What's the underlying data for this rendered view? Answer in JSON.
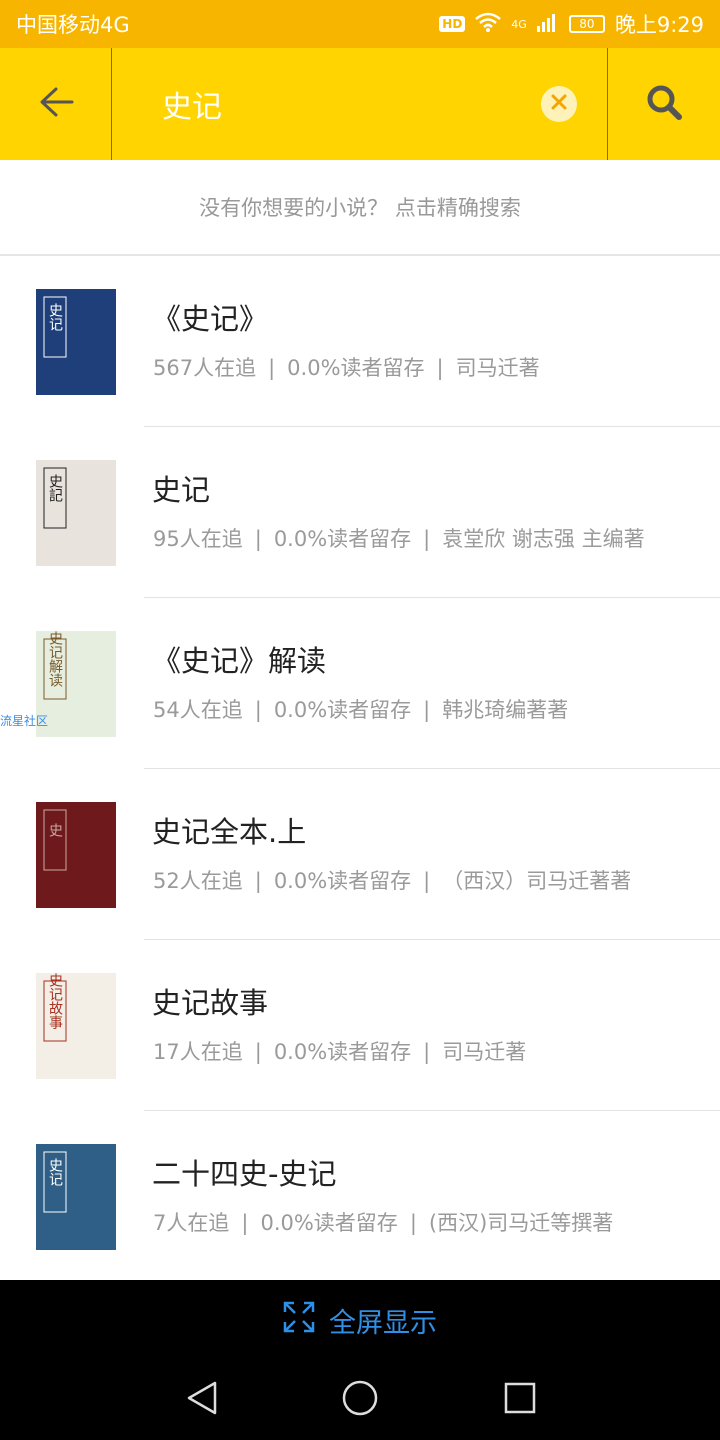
{
  "status_bar": {
    "carrier": "中国移动4G",
    "hd_badge": "HD",
    "network": "4G",
    "battery": "80",
    "time": "晚上9:29"
  },
  "search": {
    "query": "史记",
    "icons": [
      "arrow-left-icon",
      "clear-icon",
      "search-icon"
    ]
  },
  "hint": "没有你想要的小说？ 点击精确搜索",
  "results": [
    {
      "title": "《史记》",
      "followers": "567人在追",
      "retention": "0.0%读者留存",
      "author": "司马迁著",
      "cover": {
        "bg": "#1f3f7a",
        "text": "史记",
        "fg": "#ffffff"
      }
    },
    {
      "title": "史记",
      "followers": "95人在追",
      "retention": "0.0%读者留存",
      "author": "袁堂欣 谢志强 主编著",
      "cover": {
        "bg": "#e8e3dc",
        "text": "史記",
        "fg": "#222222"
      }
    },
    {
      "title": "《史记》解读",
      "followers": "54人在追",
      "retention": "0.0%读者留存",
      "author": "韩兆琦编著著",
      "cover": {
        "bg": "#e6eee0",
        "text": "史记解读",
        "fg": "#7a5a2a"
      }
    },
    {
      "title": "史记全本.上",
      "followers": "52人在追",
      "retention": "0.0%读者留存",
      "author": "（西汉）司马迁著著",
      "cover": {
        "bg": "#6e1a1d",
        "text": "史",
        "fg": "#c9a9a0"
      }
    },
    {
      "title": "史记故事",
      "followers": "17人在追",
      "retention": "0.0%读者留存",
      "author": "司马迁著",
      "cover": {
        "bg": "#f3eee6",
        "text": "史记故事",
        "fg": "#a83020"
      }
    },
    {
      "title": "二十四史-史记",
      "followers": "7人在追",
      "retention": "0.0%读者留存",
      "author": "(西汉)司马迁等撰著",
      "cover": {
        "bg": "#2f5f86",
        "text": "史记",
        "fg": "#ffffff"
      }
    }
  ],
  "watermark": "流星社区",
  "fullscreen_label": "全屏显示",
  "colors": {
    "status": "#F7B500",
    "search": "#FFD400",
    "accent_blue": "#2f8fe6"
  }
}
